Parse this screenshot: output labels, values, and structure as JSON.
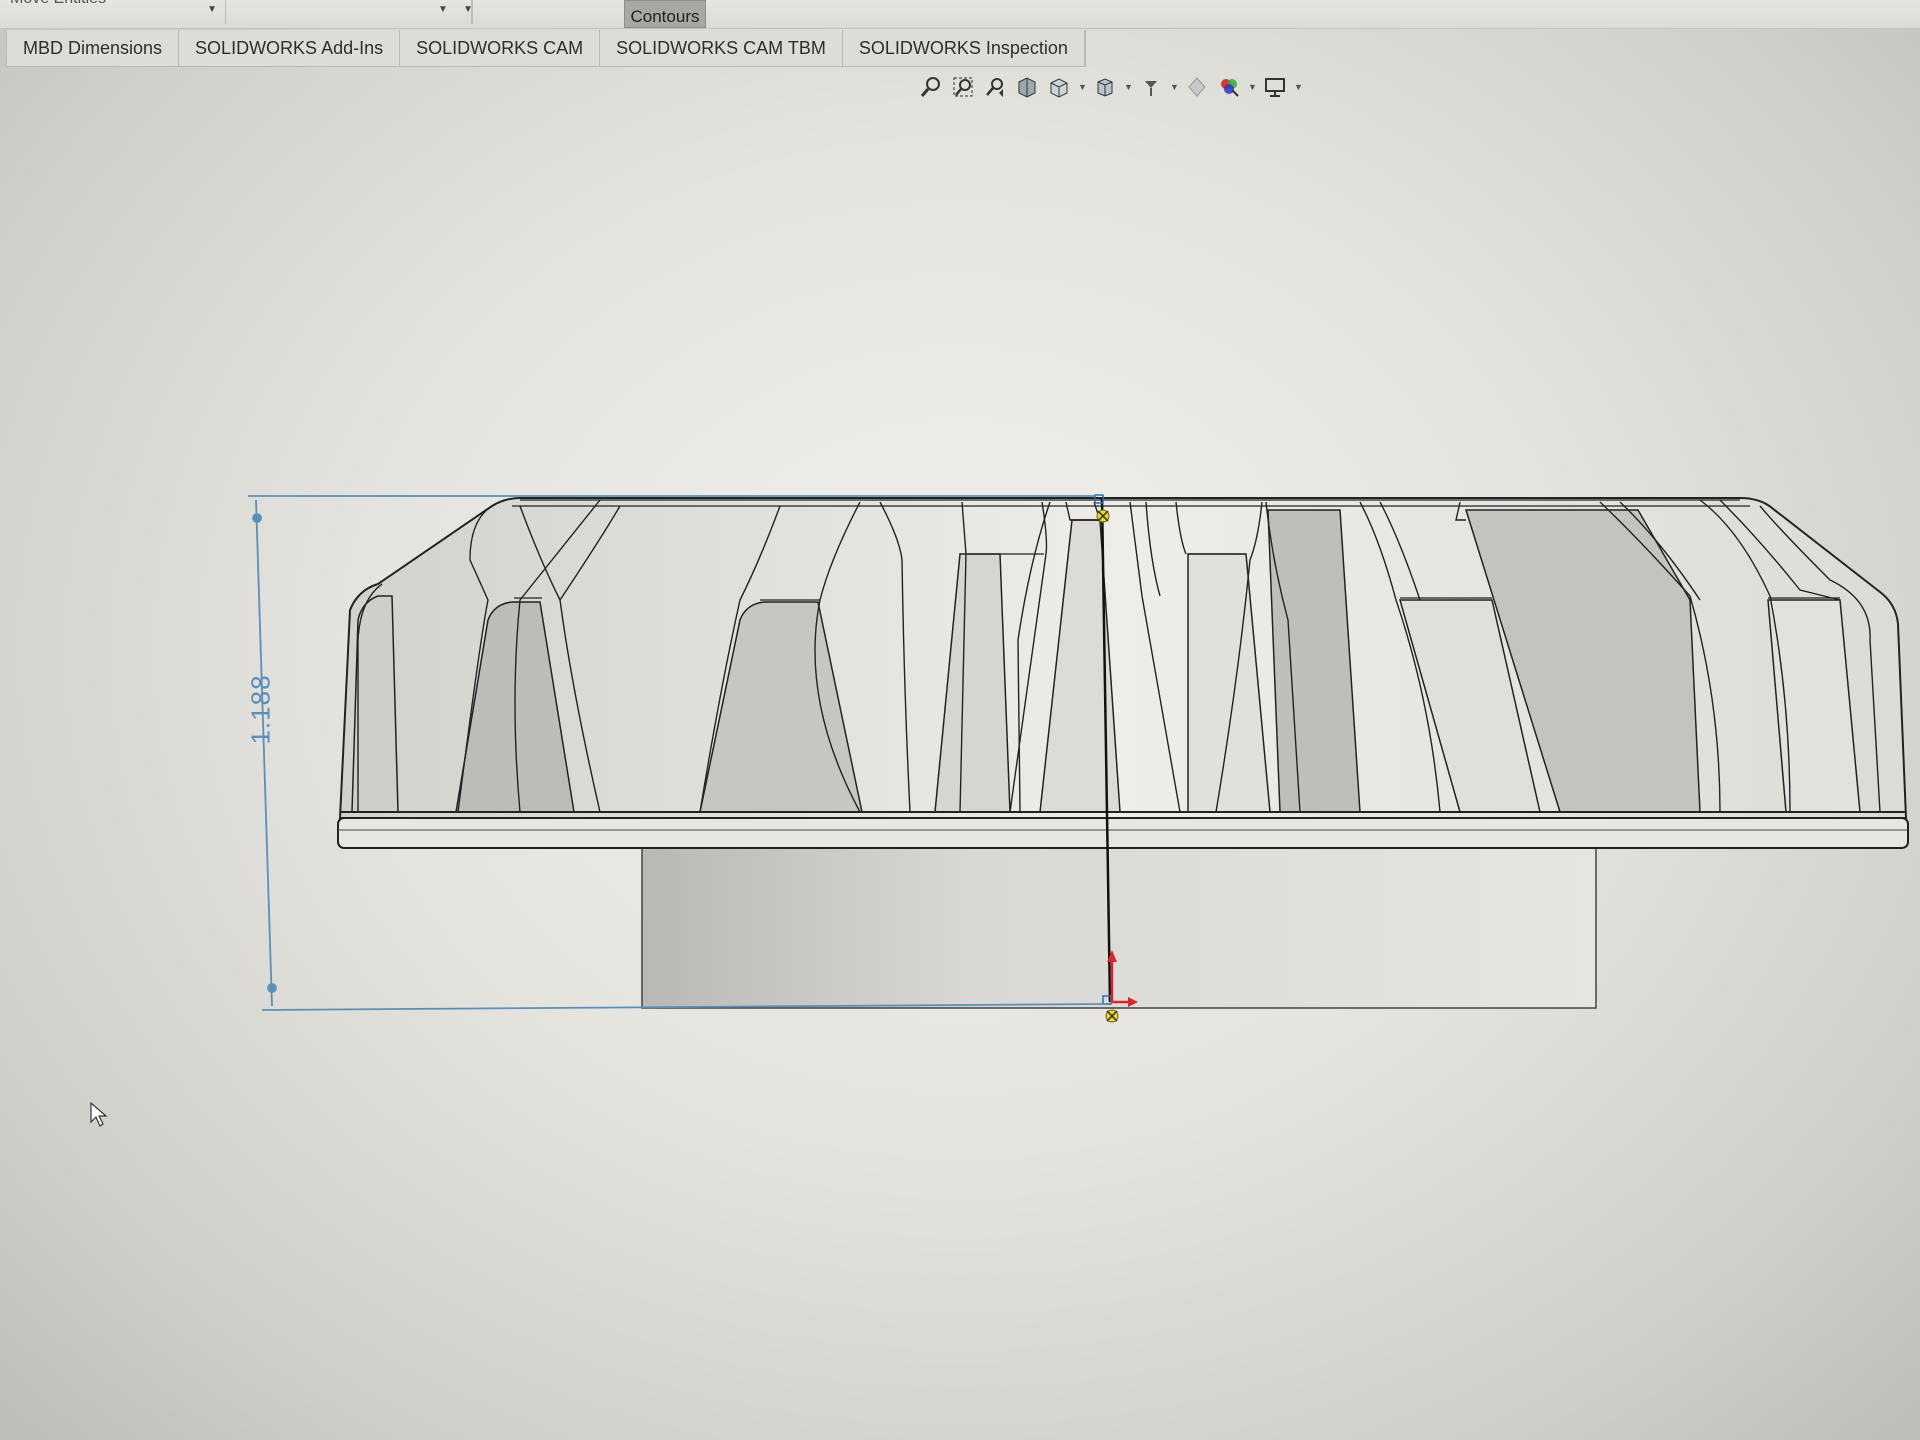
{
  "window": {
    "top_strip_label": "Move Entities",
    "contours_label": "Contours"
  },
  "tabs": [
    {
      "label": "MBD Dimensions"
    },
    {
      "label": "SOLIDWORKS Add-Ins"
    },
    {
      "label": "SOLIDWORKS CAM"
    },
    {
      "label": "SOLIDWORKS CAM TBM"
    },
    {
      "label": "SOLIDWORKS Inspection"
    }
  ],
  "view_toolbar": {
    "icons": [
      "zoom-to-fit-icon",
      "zoom-to-area-icon",
      "previous-view-icon",
      "section-view-icon",
      "dynamic-annotation-icon",
      "view-orientation-icon",
      "display-style-icon",
      "hide-show-items-icon",
      "edit-appearance-icon",
      "apply-scene-icon",
      "view-settings-icon"
    ]
  },
  "sketch": {
    "dimension_value": "1.188"
  },
  "colors": {
    "dimension": "#5b8fb8",
    "axis_x": "#d9262c",
    "axis_y": "#d9262c",
    "origin_marker": "#c8b400"
  }
}
